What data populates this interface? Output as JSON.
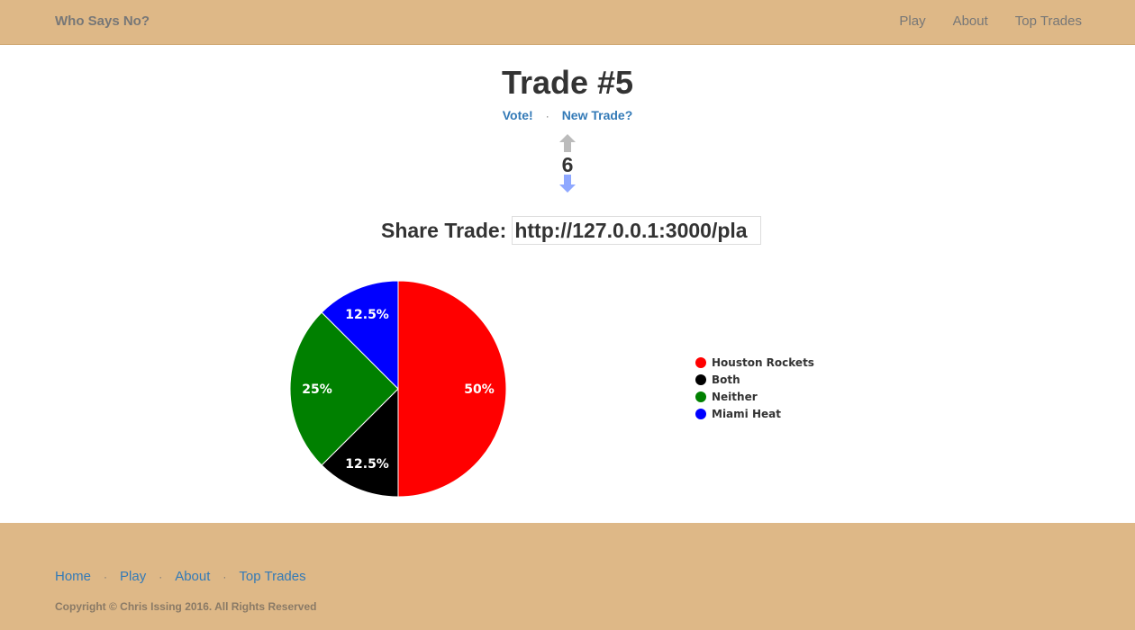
{
  "navbar": {
    "brand": "Who Says No?",
    "links": [
      "Play",
      "About",
      "Top Trades"
    ]
  },
  "trade": {
    "title": "Trade #5",
    "vote_link": "Vote!",
    "separator": "·",
    "new_trade_link": "New Trade?",
    "vote_count": "6",
    "share_label": "Share Trade:",
    "share_url": "http://127.0.0.1:3000/pla"
  },
  "chart_data": {
    "type": "pie",
    "title": "",
    "series": [
      {
        "name": "Houston Rockets",
        "value": 50,
        "label": "50%",
        "color": "#ff0000"
      },
      {
        "name": "Both",
        "value": 12.5,
        "label": "12.5%",
        "color": "#000000"
      },
      {
        "name": "Neither",
        "value": 25,
        "label": "25%",
        "color": "#008000"
      },
      {
        "name": "Miami Heat",
        "value": 12.5,
        "label": "12.5%",
        "color": "#0000ff"
      }
    ],
    "legend_position": "right"
  },
  "footer": {
    "links": [
      "Home",
      "Play",
      "About",
      "Top Trades"
    ],
    "separator": "·",
    "copyright": "Copyright © Chris Issing 2016. All Rights Reserved"
  },
  "colors": {
    "header_footer_bg": "#deb887",
    "link": "#337ab7",
    "arrow_up": "#bbbbbb",
    "arrow_down": "#8fa8ff"
  },
  "icons": {
    "upvote": "arrow-up-icon",
    "downvote": "arrow-down-icon"
  }
}
